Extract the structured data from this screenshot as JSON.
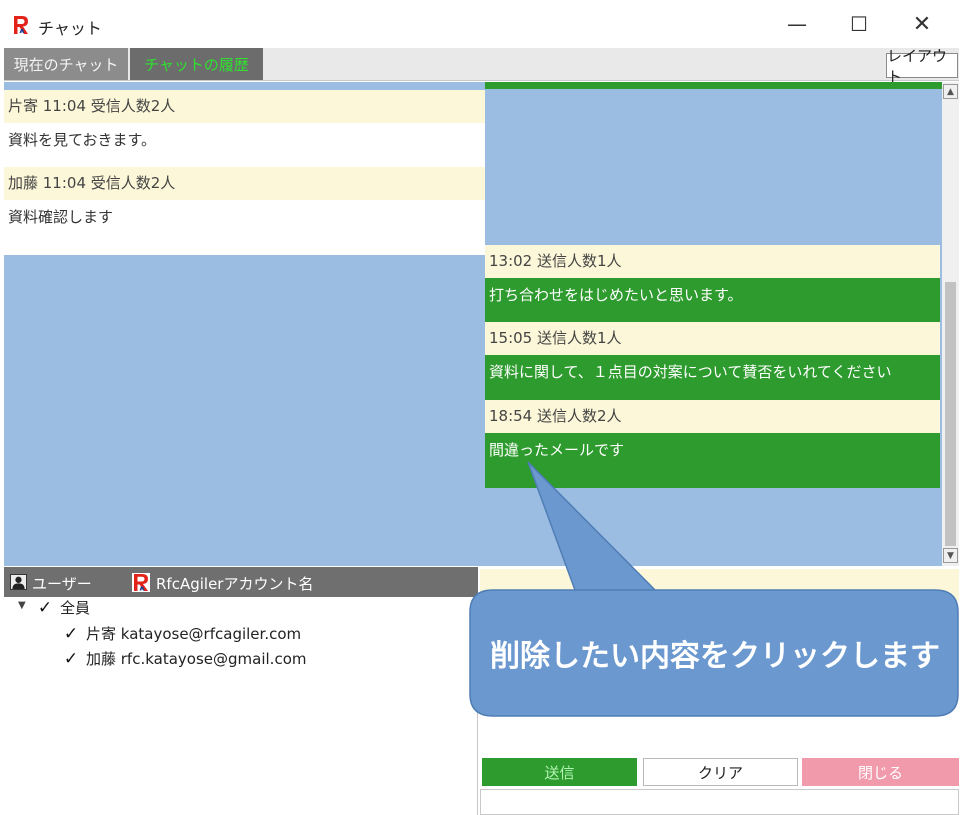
{
  "window": {
    "title": "チャット",
    "minimize_glyph": "—",
    "maximize_glyph": "☐",
    "close_glyph": "✕"
  },
  "tabs": {
    "current_chat": "現在のチャット",
    "chat_history": "チャットの履歴",
    "active": "chat_history",
    "layout_button": "レイアウト"
  },
  "incoming_messages": [
    {
      "header": "片寄  11:04  受信人数2人",
      "body": "資料を見ておきます。"
    },
    {
      "header": "加藤  11:04  受信人数2人",
      "body": "資料確認します"
    }
  ],
  "outgoing_messages": [
    {
      "header": "13:02  送信人数1人",
      "body": "打ち合わせをはじめたいと思います。"
    },
    {
      "header": "15:05  送信人数1人",
      "body": "資料に関して、１点目の対案について賛否をいれてください"
    },
    {
      "header": "18:54  送信人数2人",
      "body": "間違ったメールです"
    }
  ],
  "users_panel": {
    "users_label": "ユーザー",
    "account_label": "RfcAgilerアカウント名",
    "all_label": "全員",
    "all_checked": true,
    "users": [
      {
        "name": "片寄 katayose@rfcagiler.com",
        "checked": true
      },
      {
        "name": "加藤 rfc.katayose@gmail.com",
        "checked": true
      }
    ]
  },
  "compose": {
    "send_label": "送信",
    "clear_label": "クリア",
    "close_label": "閉じる"
  },
  "callout": {
    "text": "削除したい内容をクリックします"
  },
  "colors": {
    "chat_background": "#9bbde2",
    "message_header": "#fbf7d8",
    "outgoing_body": "#2e9b2e",
    "callout_fill": "#6a98cf",
    "close_button": "#f19aac"
  },
  "icons": {
    "app_logo": "rfc-logo-icon",
    "user": "user-icon",
    "scroll_up": "triangle-up-icon",
    "scroll_down": "triangle-down-icon",
    "expand": "triangle-down-icon",
    "checkmark": "checkmark-icon"
  }
}
